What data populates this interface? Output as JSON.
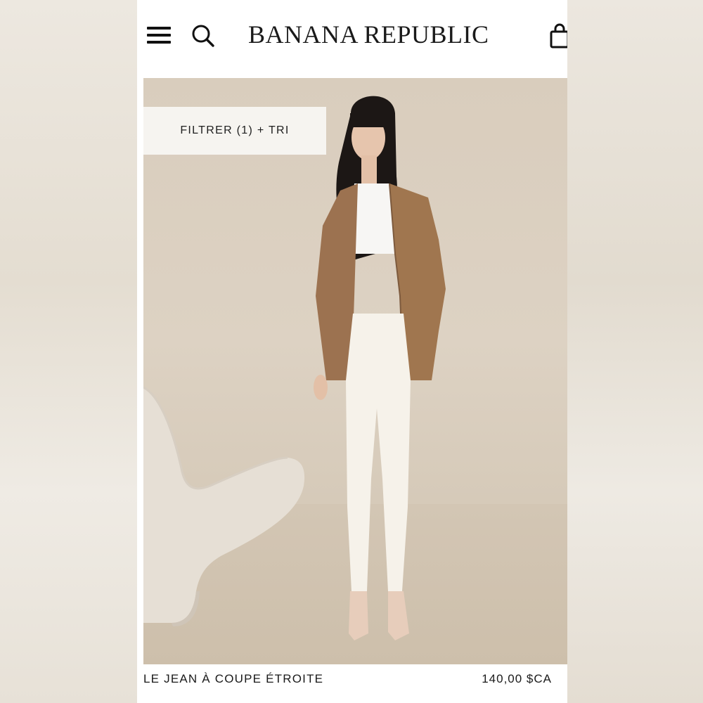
{
  "header": {
    "brand": "BANANA REPUBLIC",
    "icons": [
      "menu-icon",
      "search-icon",
      "shopping-bag-icon"
    ]
  },
  "filter": {
    "label": "FILTRER (1) + TRI"
  },
  "product": {
    "name": "LE JEAN À COUPE ÉTROITE",
    "price": "140,00 $CA",
    "image": "model-blazer-white-jeans-photo"
  },
  "colors": {
    "background": "#ffffff",
    "text": "#1a1a1a",
    "hero_bg": "#d9cdbd",
    "filter_bg": "#f6f4f0"
  }
}
